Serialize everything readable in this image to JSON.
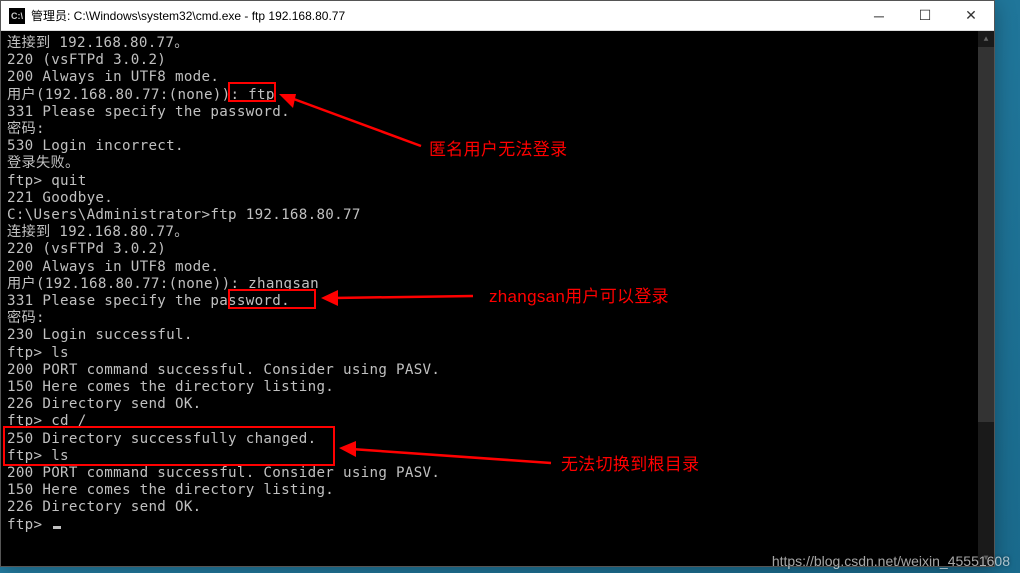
{
  "window": {
    "title": "管理员: C:\\Windows\\system32\\cmd.exe - ftp  192.168.80.77",
    "icon_label": "cmd"
  },
  "terminal": {
    "lines": [
      "连接到 192.168.80.77。",
      "220 (vsFTPd 3.0.2)",
      "200 Always in UTF8 mode.",
      "用户(192.168.80.77:(none)): ftp",
      "331 Please specify the password.",
      "密码:",
      "530 Login incorrect.",
      "登录失败。",
      "ftp> quit",
      "221 Goodbye.",
      "",
      "C:\\Users\\Administrator>ftp 192.168.80.77",
      "连接到 192.168.80.77。",
      "220 (vsFTPd 3.0.2)",
      "200 Always in UTF8 mode.",
      "用户(192.168.80.77:(none)): zhangsan",
      "331 Please specify the password.",
      "密码:",
      "230 Login successful.",
      "ftp> ls",
      "200 PORT command successful. Consider using PASV.",
      "150 Here comes the directory listing.",
      "226 Directory send OK.",
      "ftp> cd /",
      "250 Directory successfully changed.",
      "ftp> ls",
      "200 PORT command successful. Consider using PASV.",
      "150 Here comes the directory listing.",
      "226 Directory send OK.",
      "ftp> "
    ]
  },
  "annotations": {
    "a1": "匿名用户无法登录",
    "a2": "zhangsan用户可以登录",
    "a3": "无法切换到根目录"
  },
  "watermark": "https://blog.csdn.net/weixin_45551608",
  "colors": {
    "highlight": "#ff0000",
    "terminal_bg": "#000000",
    "terminal_fg": "#c0c0c0"
  }
}
